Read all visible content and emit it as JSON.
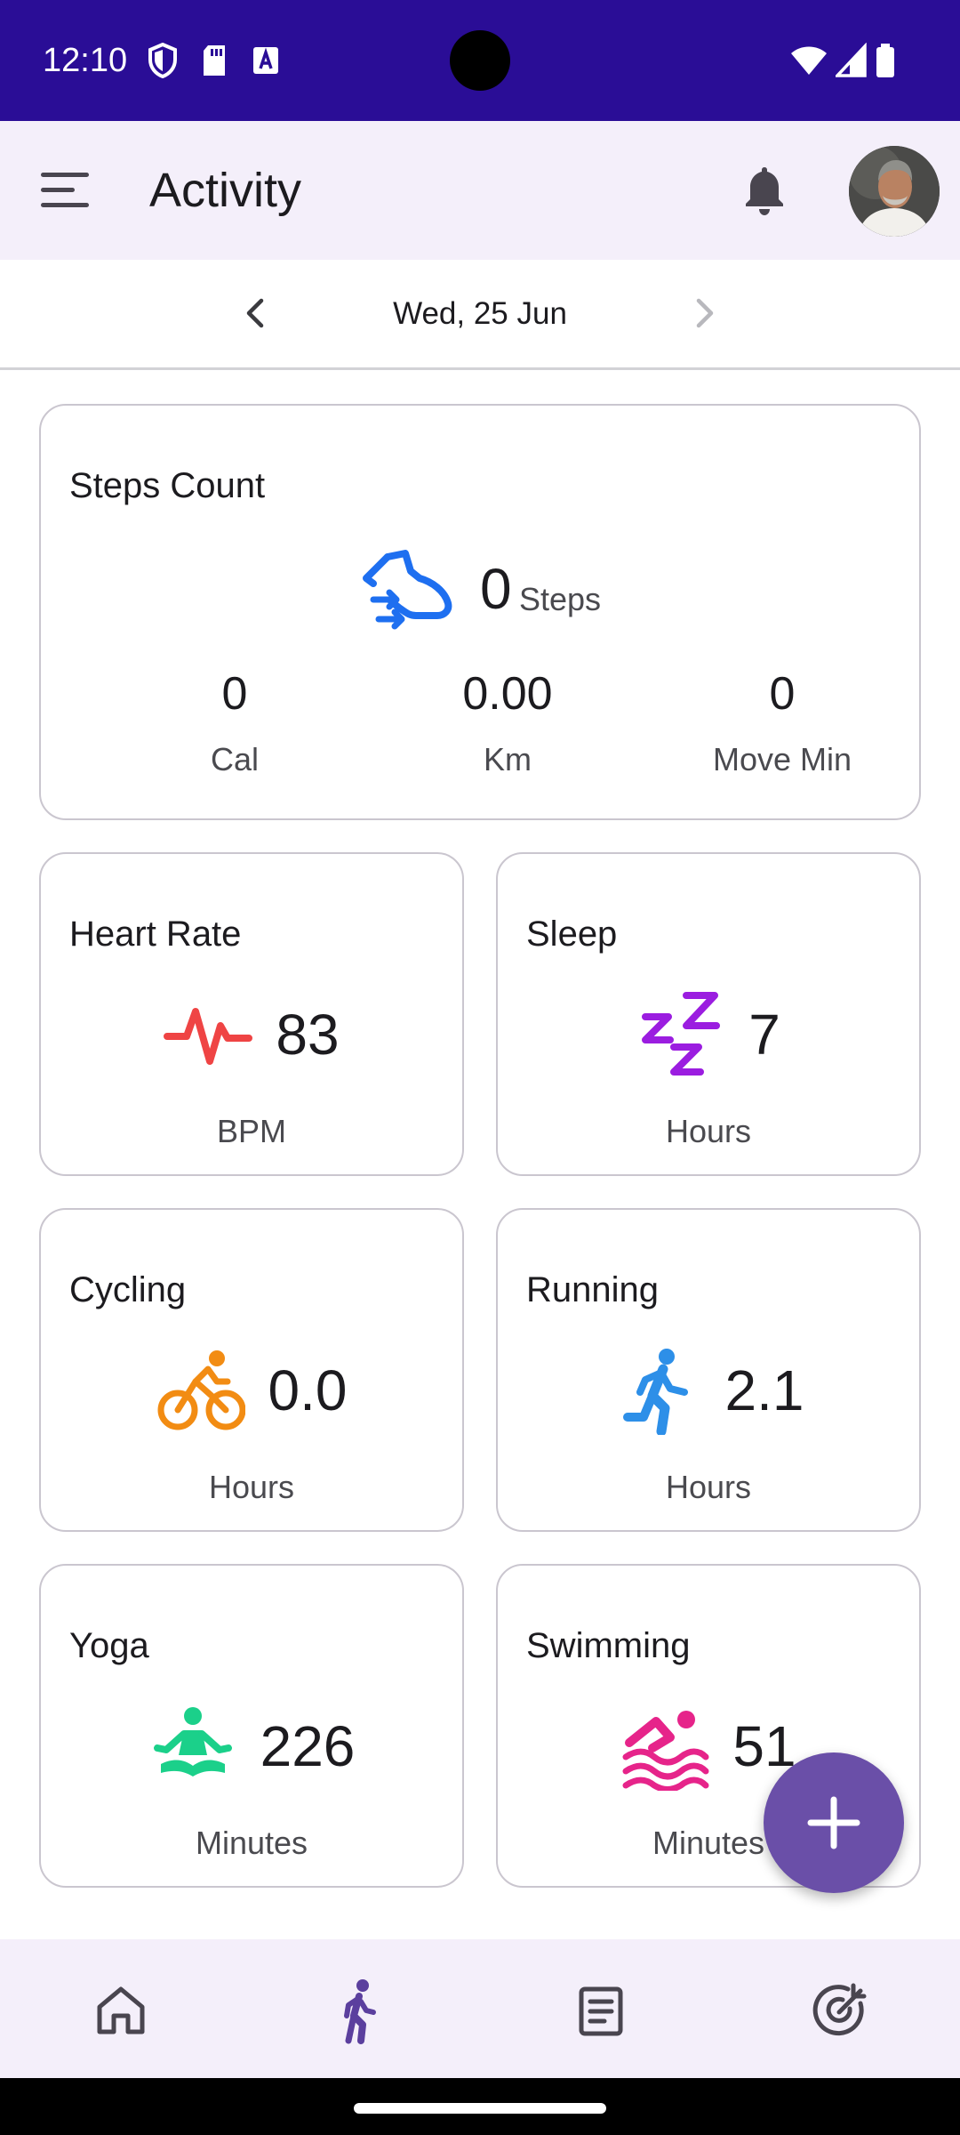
{
  "status_bar": {
    "time": "12:10"
  },
  "app_bar": {
    "title": "Activity"
  },
  "date_nav": {
    "date": "Wed, 25 Jun"
  },
  "steps_card": {
    "title": "Steps Count",
    "steps_value": "0",
    "steps_unit": "Steps",
    "stats": [
      {
        "value": "0",
        "label": "Cal"
      },
      {
        "value": "0.00",
        "label": "Km"
      },
      {
        "value": "0",
        "label": "Move Min"
      }
    ]
  },
  "cards": {
    "heart_rate": {
      "title": "Heart Rate",
      "value": "83",
      "unit": "BPM",
      "icon": "heart-pulse-icon",
      "color": "#ef4444"
    },
    "sleep": {
      "title": "Sleep",
      "value": "7",
      "unit": "Hours",
      "icon": "sleep-zzz-icon",
      "color": "#9b1de0"
    },
    "cycling": {
      "title": "Cycling",
      "value": "0.0",
      "unit": "Hours",
      "icon": "bicycle-icon",
      "color": "#f28c13"
    },
    "running": {
      "title": "Running",
      "value": "2.1",
      "unit": "Hours",
      "icon": "running-icon",
      "color": "#2d8fe8"
    },
    "yoga": {
      "title": "Yoga",
      "value": "226",
      "unit": "Minutes",
      "icon": "yoga-icon",
      "color": "#1bd08a"
    },
    "swimming": {
      "title": "Swimming",
      "value": "51",
      "unit": "Minutes",
      "icon": "swimming-icon",
      "color": "#e6248a"
    }
  },
  "colors": {
    "status_bar": "#2a0d96",
    "app_bar": "#f4effa",
    "accent": "#6a4fa8",
    "steps_icon": "#1e6ff0"
  },
  "bottom_nav": [
    {
      "icon": "home-icon"
    },
    {
      "icon": "activity-walk-icon",
      "selected": true
    },
    {
      "icon": "notes-icon"
    },
    {
      "icon": "goals-target-icon"
    }
  ]
}
